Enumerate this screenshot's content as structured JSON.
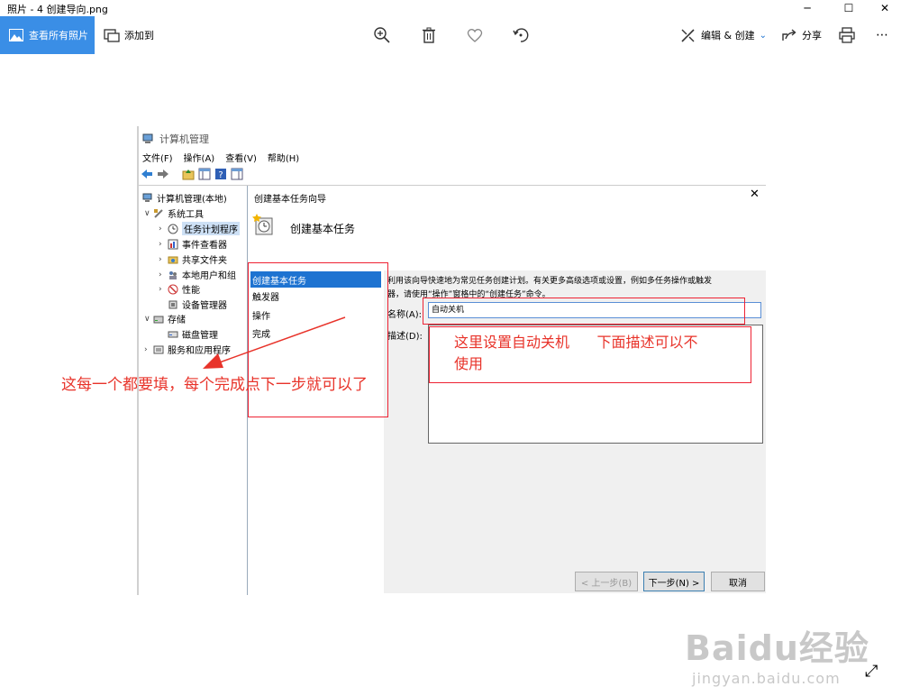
{
  "window": {
    "title": "照片 - 4 创建导向.png"
  },
  "toolbar": {
    "all_photos": "查看所有照片",
    "add_to": "添加到",
    "edit_create": "编辑 & 创建",
    "share": "分享"
  },
  "computer_mgmt": {
    "title": "计算机管理",
    "menu": [
      "文件(F)",
      "操作(A)",
      "查看(V)",
      "帮助(H)"
    ],
    "tree": {
      "root": "计算机管理(本地)",
      "system_tools": "系统工具",
      "task_scheduler": "任务计划程序",
      "event_viewer": "事件查看器",
      "shared_folders": "共享文件夹",
      "local_users": "本地用户和组",
      "performance": "性能",
      "device_manager": "设备管理器",
      "storage": "存储",
      "disk_mgmt": "磁盘管理",
      "services_apps": "服务和应用程序"
    }
  },
  "wizard": {
    "title": "创建基本任务向导",
    "heading": "创建基本任务",
    "steps": [
      "创建基本任务",
      "触发器",
      "操作",
      "完成"
    ],
    "description_line1": "利用该向导快速地为常见任务创建计划。有关更多高级选项或设置，例如多任务操作或触发",
    "description_line2": "器，请使用“操作”窗格中的“创建任务”命令。",
    "name_label": "名称(A):",
    "name_value": "自动关机",
    "desc_label": "描述(D):",
    "back_button": "< 上一步(B)",
    "next_button": "下一步(N) >",
    "cancel_button": "取消"
  },
  "annotations": {
    "left_note": "这每一个都要填，每个完成点下一步就可以了",
    "right_note_line1": "这里设置自动关机      下面描述可以不",
    "right_note_line2": "使用"
  },
  "watermark": {
    "main": "Baidu经验",
    "sub": "jingyan.baidu.com"
  }
}
